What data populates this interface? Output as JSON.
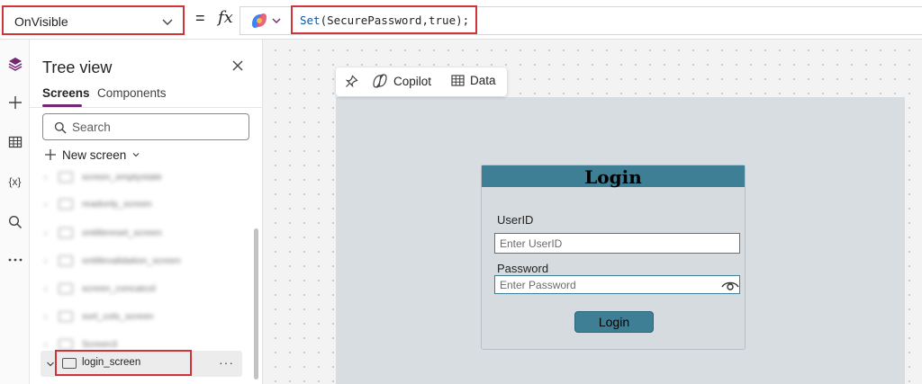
{
  "formula_bar": {
    "property": "OnVisible",
    "equals": "=",
    "fx": "fx",
    "formula_fn": "Set",
    "formula_args": "(SecurePassword,true);",
    "copilot_icon": "copilot-icon"
  },
  "left_rail": {
    "icons": [
      "layers-icon",
      "plus-icon",
      "table-icon",
      "variables-icon",
      "search-icon",
      "more-icon"
    ],
    "variables_glyph": "{x}"
  },
  "tree_view": {
    "title": "Tree view",
    "tabs": [
      "Screens",
      "Components"
    ],
    "search_placeholder": "Search",
    "new_screen": "New screen",
    "blurred_items": [
      "screen_emptystate",
      "readonly_screen",
      "ontitlereset_screen",
      "ontitlevalidation_screen",
      "screen_concatcol",
      "sort_cols_screen",
      "Screen3"
    ],
    "selected_item": "login_screen",
    "more": "···"
  },
  "canvas_toolbar": {
    "copilot": "Copilot",
    "data": "Data"
  },
  "login_form": {
    "title": "Login",
    "userid_label": "UserID",
    "userid_placeholder": "Enter UserID",
    "password_label": "Password",
    "password_placeholder": "Enter Password",
    "button": "Login"
  },
  "colors": {
    "highlight": "#d13438",
    "tab_accent": "#742774",
    "login_teal": "#3e7f96"
  }
}
